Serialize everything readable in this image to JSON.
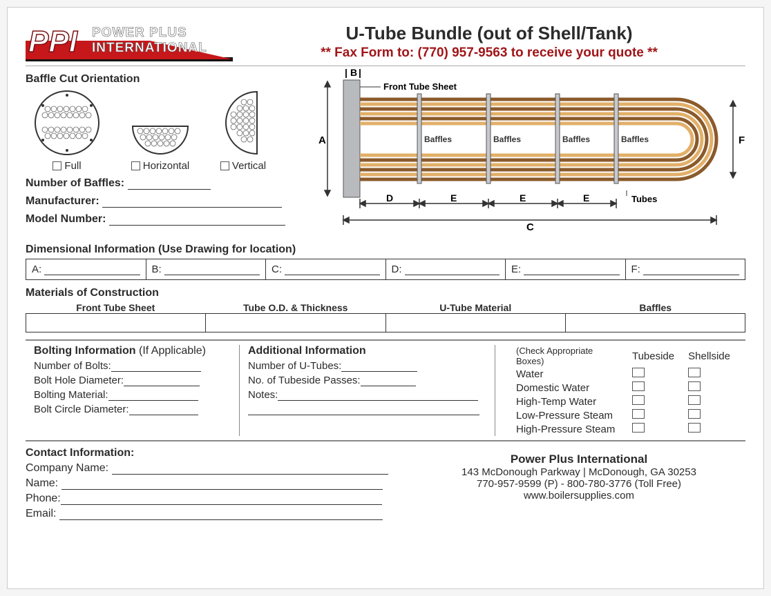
{
  "header": {
    "logo_line1": "POWER PLUS",
    "logo_line2": "INTERNATIONAL",
    "logo_abbrev": "PPI",
    "title": "U-Tube Bundle (out of Shell/Tank)",
    "fax_line": "** Fax Form to: (770) 957-9563 to receive your quote **"
  },
  "baffle": {
    "heading": "Baffle Cut Orientation",
    "options": {
      "full": "Full",
      "horizontal": "Horizontal",
      "vertical": "Vertical"
    },
    "num_label": "Number of Baffles:"
  },
  "fields": {
    "manufacturer": "Manufacturer:",
    "model_number": "Model Number:"
  },
  "diagram": {
    "front_tube_sheet": "Front Tube Sheet",
    "baffles_label": "Baffles",
    "tubes_label": "Tubes",
    "dims": {
      "A": "A",
      "B": "B",
      "C": "C",
      "D": "D",
      "E": "E",
      "F": "F"
    }
  },
  "dimensional": {
    "heading": "Dimensional Information (Use Drawing for location)",
    "labels": {
      "A": "A:",
      "B": "B:",
      "C": "C:",
      "D": "D:",
      "E": "E:",
      "F": "F:"
    }
  },
  "materials": {
    "heading": "Materials of Construction",
    "cols": {
      "front_sheet": "Front Tube Sheet",
      "tube_od": "Tube O.D. & Thickness",
      "utube": "U-Tube Material",
      "baffles": "Baffles"
    }
  },
  "bolting": {
    "heading": "Bolting Information",
    "note": "(If Applicable)",
    "num_bolts": "Number of Bolts:",
    "bolt_hole": "Bolt Hole Diameter:",
    "bolt_mat": "Bolting Material:",
    "bolt_circle": "Bolt Circle Diameter:"
  },
  "additional": {
    "heading": "Additional Information",
    "num_utubes": "Number of U-Tubes:",
    "passes": "No. of Tubeside Passes:",
    "notes": "Notes:"
  },
  "checks": {
    "hint": "(Check Appropriate Boxes)",
    "tubeside": "Tubeside",
    "shellside": "Shellside",
    "rows": {
      "water": "Water",
      "domestic": "Domestic Water",
      "hightemp": "High-Temp Water",
      "lowpress": "Low-Pressure Steam",
      "highpress": "High-Pressure Steam"
    }
  },
  "contact": {
    "heading": "Contact Information:",
    "company": "Company Name:",
    "name": "Name:",
    "phone": "Phone:",
    "email": "Email:",
    "footer": {
      "name": "Power Plus International",
      "addr": "143 McDonough Parkway   |   McDonough, GA 30253",
      "phone": "770-957-9599 (P) - 800-780-3776 (Toll Free)",
      "web": "www.boilersupplies.com"
    }
  }
}
